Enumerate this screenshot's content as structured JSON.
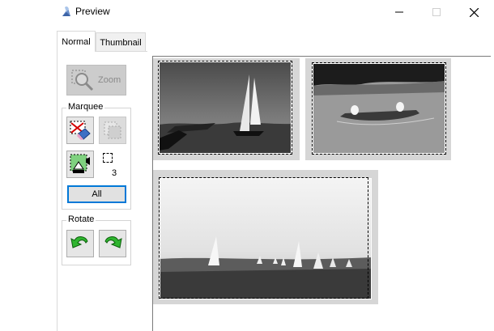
{
  "window": {
    "title": "Preview",
    "minimize_glyph": "—",
    "maximize_glyph": "☐",
    "close_glyph": "✕"
  },
  "tabs": [
    {
      "label": "Normal",
      "active": true
    },
    {
      "label": "Thumbnail",
      "active": false
    }
  ],
  "toolbar": {
    "zoom_label": "Zoom",
    "zoom_icon": "magnifier-icon"
  },
  "marquee_group": {
    "label": "Marquee",
    "delete_icon": "delete-marquee-icon",
    "duplicate_icon": "duplicate-marquee-icon",
    "autoexposure_icon": "auto-exposure-icon",
    "count": "3",
    "all_label": "All"
  },
  "rotate_group": {
    "label": "Rotate",
    "left_icon": "rotate-left-icon",
    "right_icon": "rotate-right-icon"
  },
  "preview": {
    "photos": [
      {
        "subject": "sailboat-photo"
      },
      {
        "subject": "canoe-photo"
      },
      {
        "subject": "regatta-photo"
      }
    ]
  },
  "colors": {
    "accent_blue": "#0078d7",
    "rotate_green": "#2fb52f",
    "disabled_gray": "#cccccc"
  }
}
